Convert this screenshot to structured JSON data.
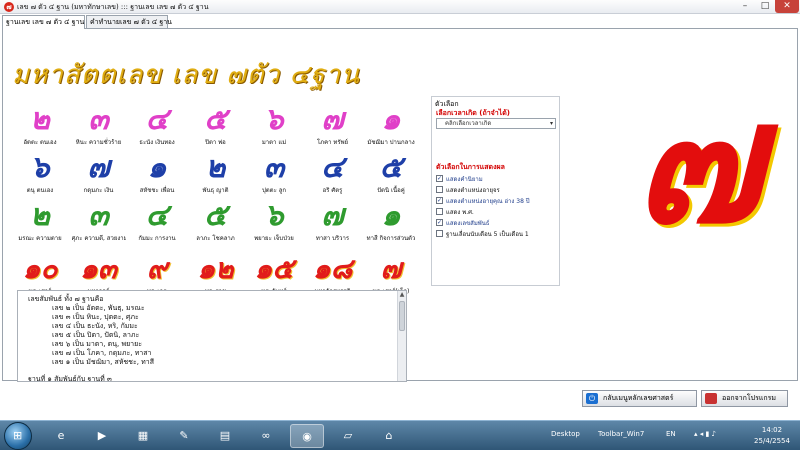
{
  "window": {
    "title": "เลข ๗ ตัว ๔ ฐาน (มหาทักษาเลข) ::: ฐานเลข เลข ๗ ตัว ๔ ฐาน",
    "app_icon": "๗",
    "minimize": "–",
    "maximize": "□",
    "close": "✕"
  },
  "tabs": [
    {
      "label": "ฐานเลข เลข ๗ ตัว ๔ ฐาน",
      "active": true
    },
    {
      "label": "คำทำนายเลข ๗ ตัว ๔ ฐาน",
      "active": false
    }
  ],
  "heading": "มหาสัตตเลข เลข ๗ตัว ๔ฐาน",
  "grid": {
    "rows": [
      [
        {
          "num": "๒",
          "label": "อัตตะ ตนเอง",
          "color": "#e040c8"
        },
        {
          "num": "๓",
          "label": "หินะ ความชั่วร้าย",
          "color": "#e040c8"
        },
        {
          "num": "๔",
          "label": "ธะนัง เงินทอง",
          "color": "#e040c8"
        },
        {
          "num": "๕",
          "label": "ปิตา พ่อ",
          "color": "#e040c8"
        },
        {
          "num": "๖",
          "label": "มาตา แม่",
          "color": "#e040c8"
        },
        {
          "num": "๗",
          "label": "โภคา ทรัพย์",
          "color": "#e040c8"
        },
        {
          "num": "๑",
          "label": "มัชฌิมา ปานกลาง",
          "color": "#e040c8"
        }
      ],
      [
        {
          "num": "๖",
          "label": "ตนุ ตนเอง",
          "color": "#1e3fa8"
        },
        {
          "num": "๗",
          "label": "กดุมภะ เงิน",
          "color": "#1e3fa8"
        },
        {
          "num": "๑",
          "label": "สหัชชะ เพื่อน",
          "color": "#1e3fa8"
        },
        {
          "num": "๒",
          "label": "พันธุ ญาติ",
          "color": "#1e3fa8"
        },
        {
          "num": "๓",
          "label": "ปุตตะ ลูก",
          "color": "#1e3fa8"
        },
        {
          "num": "๔",
          "label": "อริ ศัตรู",
          "color": "#1e3fa8"
        },
        {
          "num": "๕",
          "label": "ปัตนิ เนื้อคู่",
          "color": "#1e3fa8"
        }
      ],
      [
        {
          "num": "๒",
          "label": "มรณะ ความตาย",
          "color": "#2f9b2f"
        },
        {
          "num": "๓",
          "label": "ศุภะ ความดี, สวยงาม",
          "color": "#2f9b2f"
        },
        {
          "num": "๔",
          "label": "กัมมะ การงาน",
          "color": "#2f9b2f"
        },
        {
          "num": "๕",
          "label": "ลาภะ โชคลาภ",
          "color": "#2f9b2f"
        },
        {
          "num": "๖",
          "label": "พยายะ เจ็บป่วย",
          "color": "#2f9b2f"
        },
        {
          "num": "๗",
          "label": "ทาสา บริวาร",
          "color": "#2f9b2f"
        },
        {
          "num": "๑",
          "label": "ทาสี กิจการส่วนตัว",
          "color": "#2f9b2f"
        }
      ],
      [
        {
          "num": "๑๐",
          "label": "พระเสาร์"
        },
        {
          "num": "๑๓",
          "label": "มหาอุจจ์"
        },
        {
          "num": "๙",
          "label": "พระเกตุ"
        },
        {
          "num": "๑๒",
          "label": "พระราชู"
        },
        {
          "num": "๑๕",
          "label": "พระจันทร์"
        },
        {
          "num": "๑๘",
          "label": "มหาจักรพรรดิ"
        },
        {
          "num": "๗",
          "label": "พระเสาร์(เล็ก)"
        }
      ]
    ]
  },
  "list_box": {
    "lines": [
      "เลขสัมพันธ์ ทั้ง ๗  ฐานคือ",
      "เลข ๒ เป็น อัตตะ, พันธุ, มรณะ",
      "เลข ๓ เป็น หินะ, ปุตตะ, ศุภะ",
      "เลข ๔ เป็น ธะนัง, หริ, กัมมะ",
      "เลข ๕ เป็น ปิตา, ปัตนิ, ลาภะ",
      "เลข ๖ เป็น มาตา, ตนุ, พยายะ",
      "เลข ๗ เป็น โภคา, กดุมภะ, ทาสา",
      "เลข ๑ เป็น มัชฌิมา, สหัชชะ, ทาสี",
      "ฐานที่ ๑ สัมพันธ์กับ ฐานที่ ๓"
    ],
    "scroll_up": "▲"
  },
  "options": {
    "title": "ตัวเลือก",
    "time_label": "เลือกเวลาเกิด (ถ้าจำได้)",
    "time_select": "คลิกเลือกเวลาเกิด",
    "dropdown_arrow": "▾",
    "display_label": "ตัวเลือกในการแสดงผล",
    "checkboxes": [
      {
        "label": "แสดงคำนิยาม",
        "checked": true,
        "color": "#1e3c8a"
      },
      {
        "label": "แสดงตำแหน่งอายุจร",
        "checked": false,
        "color": "#111111"
      },
      {
        "label": "แสดงตำแหน่งอายุคุณ อ่าง 38 ปี",
        "checked": true,
        "color": "#1e3c8a"
      },
      {
        "label": "แสดง พ.ศ.",
        "checked": false,
        "color": "#111111"
      },
      {
        "label": "แสดงเลขสัมพันธ์",
        "checked": true,
        "color": "#1e3c8a"
      },
      {
        "label": "ฐานเลื่อนนับเดือน 5 เป็นเดือน 1",
        "checked": false,
        "color": "#111111"
      }
    ],
    "check_mark": "✓"
  },
  "big_number": "๗",
  "buttons": {
    "menu_label": "กลับเมนูหลักเลขศาสตร์",
    "menu_icon": "⏻",
    "exit_label": "ออกจากโปรแกรม"
  },
  "taskbar": {
    "start_icon": "⊞",
    "apps": [
      {
        "icon": "e",
        "name": "ie",
        "active": false
      },
      {
        "icon": "▶",
        "name": "media",
        "active": false
      },
      {
        "icon": "▦",
        "name": "explorer",
        "active": false
      },
      {
        "icon": "✎",
        "name": "paint",
        "active": false
      },
      {
        "icon": "▤",
        "name": "doc",
        "active": false
      },
      {
        "icon": "∞",
        "name": "network",
        "active": false
      },
      {
        "icon": "◉",
        "name": "app",
        "active": true
      },
      {
        "icon": "▱",
        "name": "tool",
        "active": false
      },
      {
        "icon": "⌂",
        "name": "home",
        "active": false
      }
    ],
    "desktop_label": "Desktop",
    "toolbar_label": "Toolbar_Win7",
    "lang": "EN",
    "tray_icons": "▴ ◂ ▮ ♪",
    "time": "14:02",
    "date": "25/4/2554"
  }
}
